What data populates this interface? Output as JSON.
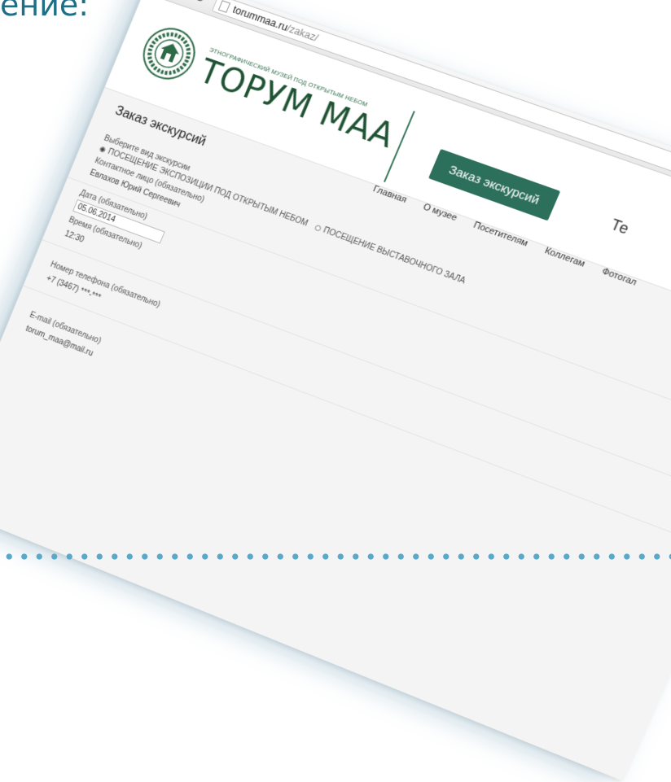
{
  "slide": {
    "heading_fragment": "ение:"
  },
  "browser": {
    "url_host": "torummaa.ru",
    "url_path": "/zakaz/"
  },
  "site": {
    "tagline": "ЭТНОГРАФИЧЕСКИЙ МУЗЕЙ ПОД ОТКРЫТЫМ НЕБОМ",
    "title": "ТОРУМ МАА",
    "cta_label": "Заказ экскурсий",
    "header_right_text": "Те",
    "nav": [
      "Главная",
      "О музее",
      "Посетителям",
      "Коллегам",
      "Фотогал"
    ]
  },
  "form": {
    "page_title": "Заказ экскурсий",
    "excursion_type_label": "Выберите вид экскурсии",
    "option_1": "ПОСЕЩЕНИЕ ЭКСПОЗИЦИИ ПОД ОТКРЫТЫМ НЕБОМ",
    "option_2": "ПОСЕЩЕНИЕ ВЫСТАВОЧНОГО ЗАЛА",
    "contact_label": "Контактное лицо (обязательно)",
    "contact_value": "Евлахов Юрий Сергеевич",
    "date_label": "Дата (обязательно)",
    "date_value": "05.06.2014",
    "time_label": "Время (обязательно)",
    "time_value": "12:30",
    "phone_label": "Номер телефона (обязательно)",
    "phone_value": "+7 (3467) ***-***",
    "email_label": "E-mail (обязательно)",
    "email_value": "torum_maa@mail.ru"
  },
  "colors": {
    "heading": "#1e6f86",
    "brand_green": "#1e5233",
    "cta": "#2c6f5b"
  }
}
